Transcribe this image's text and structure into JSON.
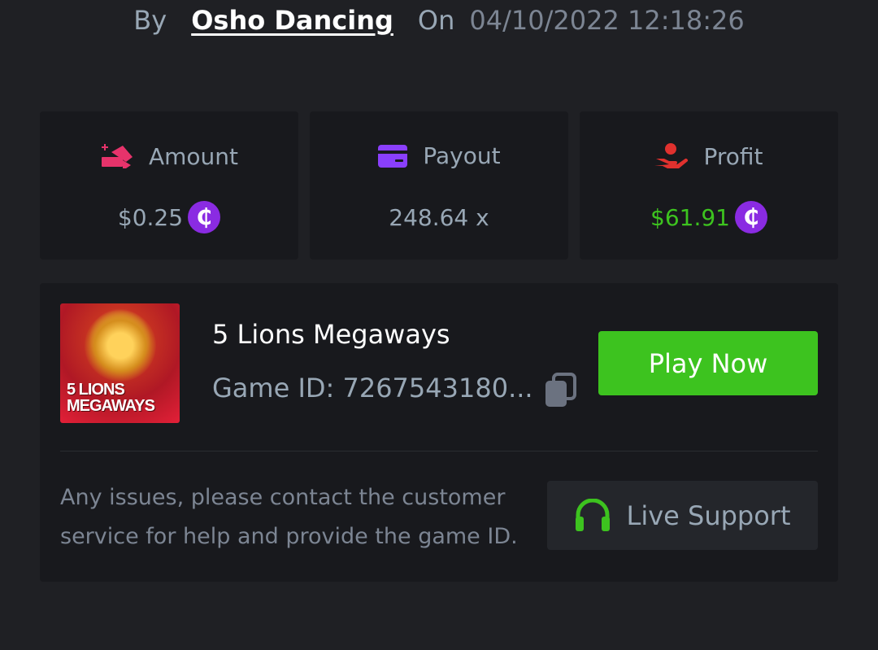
{
  "byline": {
    "by_label": "By",
    "user": "Osho Dancing",
    "on_label": "On",
    "datetime": "04/10/2022 12:18:26"
  },
  "stats": {
    "amount": {
      "label": "Amount",
      "value": "$0.25",
      "icon": "wager-icon",
      "coin": "₵"
    },
    "payout": {
      "label": "Payout",
      "value": "248.64 x",
      "icon": "card-icon"
    },
    "profit": {
      "label": "Profit",
      "value": "$61.91",
      "icon": "profit-hand-icon",
      "coin": "₵"
    }
  },
  "game": {
    "title": "5 Lions Megaways",
    "id_text": "Game ID: 7267543180...",
    "play_label": "Play Now",
    "thumb_text_line1": "5 LIONS",
    "thumb_text_line2": "MEGAWAYS"
  },
  "support": {
    "notice": "Any issues, please contact the customer service for help and provide the game ID.",
    "button_label": "Live Support"
  },
  "colors": {
    "background": "#1f2024",
    "card": "#18191d",
    "accent_green": "#3dc31f",
    "coin_purple": "#8a2be2",
    "amount_pink": "#e6336b",
    "payout_purple": "#8a3ffc",
    "profit_red": "#e0312e"
  }
}
